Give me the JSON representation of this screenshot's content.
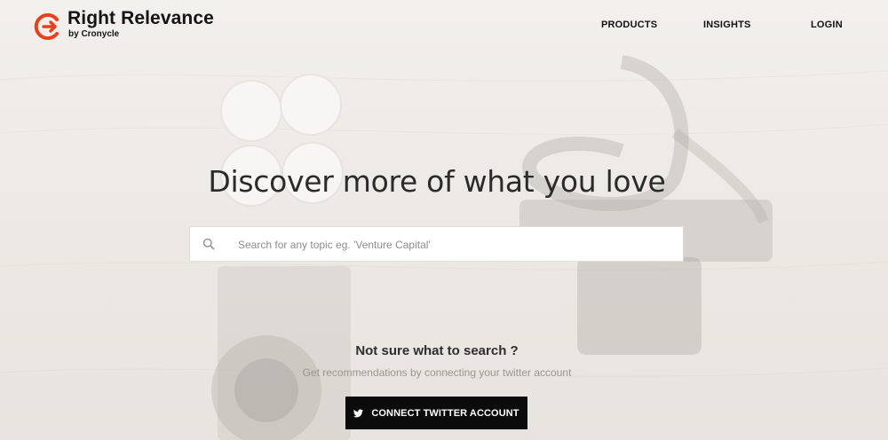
{
  "brand": {
    "name": "Right Relevance",
    "tagline": "by Cronycle",
    "accent": "#e8401c"
  },
  "nav": {
    "products": "PRODUCTS",
    "insights": "INSIGHTS",
    "login": "LOGIN"
  },
  "hero": {
    "title": "Discover more of what you love"
  },
  "search": {
    "placeholder": "Search for any topic eg. 'Venture Capital'"
  },
  "recommend": {
    "question": "Not sure what to search ?",
    "subtext": "Get recommendations by connecting your twitter account",
    "button_label": "CONNECT TWITTER ACCOUNT"
  },
  "icons": {
    "logo": "right-relevance-logo-icon",
    "search": "search-icon",
    "twitter": "twitter-bird-icon"
  }
}
